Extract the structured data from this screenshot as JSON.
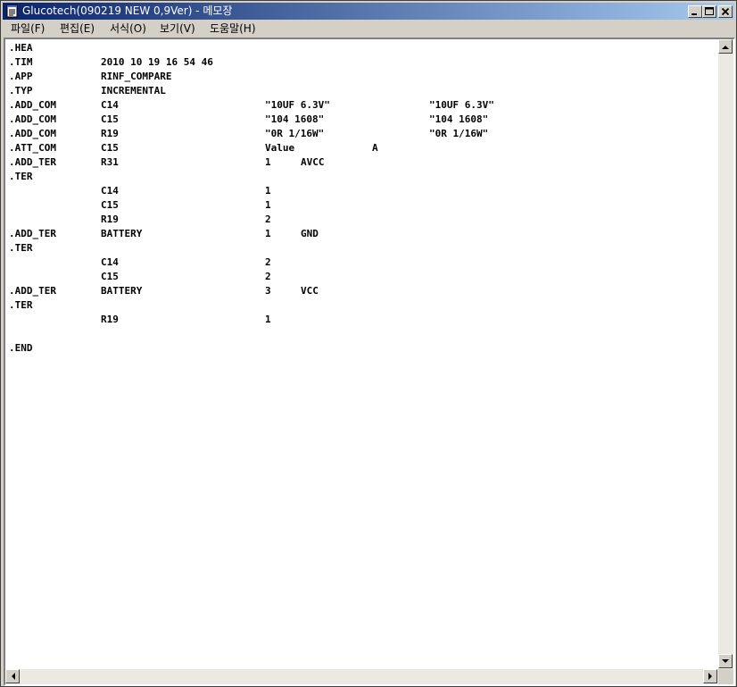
{
  "window": {
    "title": "Glucotech(090219 NEW 0,9Ver) - 메모장",
    "minimize_icon": "minimize-icon",
    "maximize_icon": "maximize-icon",
    "close_icon": "close-icon"
  },
  "menu": {
    "items": [
      {
        "label": "파일(F)"
      },
      {
        "label": "편집(E)"
      },
      {
        "label": "서식(O)"
      },
      {
        "label": "보기(V)"
      },
      {
        "label": "도움말(H)"
      }
    ]
  },
  "document": {
    "lines": [
      [
        ".HEA",
        "",
        "",
        "",
        ""
      ],
      [
        ".TIM",
        "2010 10 19 16 54 46",
        "",
        "",
        ""
      ],
      [
        ".APP",
        "RINF_COMPARE",
        "",
        "",
        ""
      ],
      [
        ".TYP",
        "INCREMENTAL",
        "",
        "",
        ""
      ],
      [
        ".ADD_COM",
        "C14",
        "\"10UF 6.3V\"",
        "",
        "\"10UF 6.3V\""
      ],
      [
        ".ADD_COM",
        "C15",
        "\"104 1608\"",
        "",
        "\"104 1608\""
      ],
      [
        ".ADD_COM",
        "R19",
        "\"0R 1/16W\"",
        "",
        "\"0R 1/16W\""
      ],
      [
        ".ATT_COM",
        "C15",
        "Value",
        "A",
        ""
      ],
      [
        ".ADD_TER",
        "R31",
        "1",
        "AVCC",
        ""
      ],
      [
        "    .TER",
        "",
        "",
        "",
        ""
      ],
      [
        "",
        "C14",
        "1",
        "",
        ""
      ],
      [
        "",
        "C15",
        "1",
        "",
        ""
      ],
      [
        "",
        "R19",
        "2",
        "",
        ""
      ],
      [
        ".ADD_TER",
        "BATTERY",
        "1",
        "GND",
        ""
      ],
      [
        "    .TER",
        "",
        "",
        "",
        ""
      ],
      [
        "",
        "C14",
        "2",
        "",
        ""
      ],
      [
        "",
        "C15",
        "2",
        "",
        ""
      ],
      [
        ".ADD_TER",
        "BATTERY",
        "3",
        "VCC",
        ""
      ],
      [
        "    .TER",
        "",
        "",
        "",
        ""
      ],
      [
        "",
        "R19",
        "1",
        "",
        ""
      ],
      [
        "",
        "",
        "",
        "",
        ""
      ],
      [
        ".END",
        "",
        "",
        "",
        ""
      ]
    ]
  },
  "colors": {
    "title_bar_start": "#0a246a",
    "title_bar_end": "#a6caf0",
    "chrome": "#d4d0c8"
  }
}
